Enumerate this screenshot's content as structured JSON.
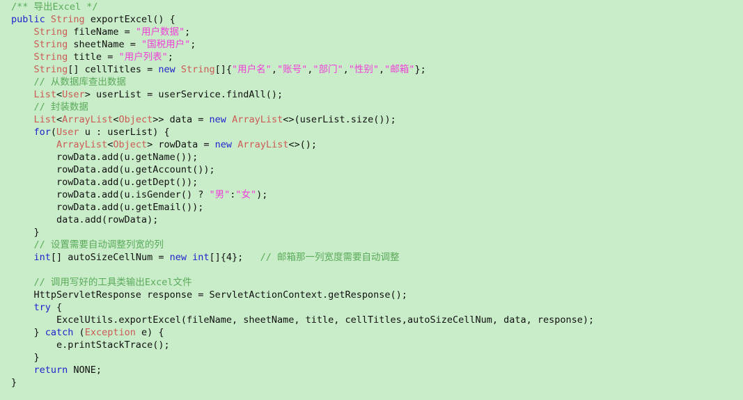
{
  "editor": {
    "language": "Java",
    "background_color": "#c9edc9",
    "colors": {
      "keyword": "#2222cc",
      "type": "#cc5a55",
      "string": "#ef3fd8",
      "comment": "#5aaa5a",
      "plain": "#101010"
    }
  },
  "code": {
    "lines": [
      {
        "id": 1,
        "tokens": [
          {
            "t": "cmt",
            "v": "/** 导出Excel */"
          }
        ]
      },
      {
        "id": 2,
        "tokens": [
          {
            "t": "kw",
            "v": "public"
          },
          {
            "t": "pln",
            "v": " "
          },
          {
            "t": "typ",
            "v": "String"
          },
          {
            "t": "pln",
            "v": " exportExcel() {"
          }
        ]
      },
      {
        "id": 3,
        "tokens": [
          {
            "t": "pln",
            "v": "    "
          },
          {
            "t": "typ",
            "v": "String"
          },
          {
            "t": "pln",
            "v": " fileName = "
          },
          {
            "t": "str",
            "v": "\"用户数据\""
          },
          {
            "t": "pln",
            "v": ";"
          }
        ]
      },
      {
        "id": 4,
        "tokens": [
          {
            "t": "pln",
            "v": "    "
          },
          {
            "t": "typ",
            "v": "String"
          },
          {
            "t": "pln",
            "v": " sheetName = "
          },
          {
            "t": "str",
            "v": "\"国税用户\""
          },
          {
            "t": "pln",
            "v": ";"
          }
        ]
      },
      {
        "id": 5,
        "tokens": [
          {
            "t": "pln",
            "v": "    "
          },
          {
            "t": "typ",
            "v": "String"
          },
          {
            "t": "pln",
            "v": " title = "
          },
          {
            "t": "str",
            "v": "\"用户列表\""
          },
          {
            "t": "pln",
            "v": ";"
          }
        ]
      },
      {
        "id": 6,
        "tokens": [
          {
            "t": "pln",
            "v": "    "
          },
          {
            "t": "typ",
            "v": "String"
          },
          {
            "t": "pln",
            "v": "[] cellTitles = "
          },
          {
            "t": "kw",
            "v": "new"
          },
          {
            "t": "pln",
            "v": " "
          },
          {
            "t": "typ",
            "v": "String"
          },
          {
            "t": "pln",
            "v": "[]{"
          },
          {
            "t": "str",
            "v": "\"用户名\""
          },
          {
            "t": "pln",
            "v": ","
          },
          {
            "t": "str",
            "v": "\"账号\""
          },
          {
            "t": "pln",
            "v": ","
          },
          {
            "t": "str",
            "v": "\"部门\""
          },
          {
            "t": "pln",
            "v": ","
          },
          {
            "t": "str",
            "v": "\"性别\""
          },
          {
            "t": "pln",
            "v": ","
          },
          {
            "t": "str",
            "v": "\"邮箱\""
          },
          {
            "t": "pln",
            "v": "};"
          }
        ]
      },
      {
        "id": 7,
        "tokens": [
          {
            "t": "pln",
            "v": "    "
          },
          {
            "t": "cmt",
            "v": "// 从数据库查出数据"
          }
        ]
      },
      {
        "id": 8,
        "tokens": [
          {
            "t": "pln",
            "v": "    "
          },
          {
            "t": "typ",
            "v": "List"
          },
          {
            "t": "pln",
            "v": "<"
          },
          {
            "t": "typ",
            "v": "User"
          },
          {
            "t": "pln",
            "v": "> userList = userService.findAll();"
          }
        ]
      },
      {
        "id": 9,
        "tokens": [
          {
            "t": "pln",
            "v": "    "
          },
          {
            "t": "cmt",
            "v": "// 封装数据"
          }
        ]
      },
      {
        "id": 10,
        "tokens": [
          {
            "t": "pln",
            "v": "    "
          },
          {
            "t": "typ",
            "v": "List"
          },
          {
            "t": "pln",
            "v": "<"
          },
          {
            "t": "typ",
            "v": "ArrayList"
          },
          {
            "t": "pln",
            "v": "<"
          },
          {
            "t": "typ",
            "v": "Object"
          },
          {
            "t": "pln",
            "v": ">> data = "
          },
          {
            "t": "kw",
            "v": "new"
          },
          {
            "t": "pln",
            "v": " "
          },
          {
            "t": "typ",
            "v": "ArrayList"
          },
          {
            "t": "pln",
            "v": "<>(userList.size());"
          }
        ]
      },
      {
        "id": 11,
        "tokens": [
          {
            "t": "pln",
            "v": "    "
          },
          {
            "t": "kw",
            "v": "for"
          },
          {
            "t": "pln",
            "v": "("
          },
          {
            "t": "typ",
            "v": "User"
          },
          {
            "t": "pln",
            "v": " u : userList) {"
          }
        ]
      },
      {
        "id": 12,
        "tokens": [
          {
            "t": "pln",
            "v": "        "
          },
          {
            "t": "typ",
            "v": "ArrayList"
          },
          {
            "t": "pln",
            "v": "<"
          },
          {
            "t": "typ",
            "v": "Object"
          },
          {
            "t": "pln",
            "v": "> rowData = "
          },
          {
            "t": "kw",
            "v": "new"
          },
          {
            "t": "pln",
            "v": " "
          },
          {
            "t": "typ",
            "v": "ArrayList"
          },
          {
            "t": "pln",
            "v": "<>();"
          }
        ]
      },
      {
        "id": 13,
        "tokens": [
          {
            "t": "pln",
            "v": "        rowData.add(u.getName());"
          }
        ]
      },
      {
        "id": 14,
        "tokens": [
          {
            "t": "pln",
            "v": "        rowData.add(u.getAccount());"
          }
        ]
      },
      {
        "id": 15,
        "tokens": [
          {
            "t": "pln",
            "v": "        rowData.add(u.getDept());"
          }
        ]
      },
      {
        "id": 16,
        "tokens": [
          {
            "t": "pln",
            "v": "        rowData.add(u.isGender() ? "
          },
          {
            "t": "str",
            "v": "\"男\""
          },
          {
            "t": "pln",
            "v": ":"
          },
          {
            "t": "str",
            "v": "\"女\""
          },
          {
            "t": "pln",
            "v": ");"
          }
        ]
      },
      {
        "id": 17,
        "tokens": [
          {
            "t": "pln",
            "v": "        rowData.add(u.getEmail());"
          }
        ]
      },
      {
        "id": 18,
        "tokens": [
          {
            "t": "pln",
            "v": "        data.add(rowData);"
          }
        ]
      },
      {
        "id": 19,
        "tokens": [
          {
            "t": "pln",
            "v": "    }"
          }
        ]
      },
      {
        "id": 20,
        "tokens": [
          {
            "t": "pln",
            "v": "    "
          },
          {
            "t": "cmt",
            "v": "// 设置需要自动调整列宽的列"
          }
        ]
      },
      {
        "id": 21,
        "tokens": [
          {
            "t": "pln",
            "v": "    "
          },
          {
            "t": "kw",
            "v": "int"
          },
          {
            "t": "pln",
            "v": "[] autoSizeCellNum = "
          },
          {
            "t": "kw",
            "v": "new"
          },
          {
            "t": "pln",
            "v": " "
          },
          {
            "t": "kw",
            "v": "int"
          },
          {
            "t": "pln",
            "v": "[]{4};   "
          },
          {
            "t": "cmt",
            "v": "// 邮箱那一列宽度需要自动调整"
          }
        ]
      },
      {
        "id": 22,
        "tokens": []
      },
      {
        "id": 23,
        "tokens": [
          {
            "t": "pln",
            "v": "    "
          },
          {
            "t": "cmt",
            "v": "// 调用写好的工具类输出Excel文件"
          }
        ]
      },
      {
        "id": 24,
        "tokens": [
          {
            "t": "pln",
            "v": "    HttpServletResponse response = ServletActionContext.getResponse();"
          }
        ]
      },
      {
        "id": 25,
        "tokens": [
          {
            "t": "pln",
            "v": "    "
          },
          {
            "t": "kw",
            "v": "try"
          },
          {
            "t": "pln",
            "v": " {"
          }
        ]
      },
      {
        "id": 26,
        "tokens": [
          {
            "t": "pln",
            "v": "        ExcelUtils.exportExcel(fileName, sheetName, title, cellTitles,autoSizeCellNum, data, response);"
          }
        ]
      },
      {
        "id": 27,
        "tokens": [
          {
            "t": "pln",
            "v": "    } "
          },
          {
            "t": "kw",
            "v": "catch"
          },
          {
            "t": "pln",
            "v": " ("
          },
          {
            "t": "typ",
            "v": "Exception"
          },
          {
            "t": "pln",
            "v": " e) {"
          }
        ]
      },
      {
        "id": 28,
        "tokens": [
          {
            "t": "pln",
            "v": "        e.printStackTrace();"
          }
        ]
      },
      {
        "id": 29,
        "tokens": [
          {
            "t": "pln",
            "v": "    }"
          }
        ]
      },
      {
        "id": 30,
        "tokens": [
          {
            "t": "pln",
            "v": "    "
          },
          {
            "t": "kw",
            "v": "return"
          },
          {
            "t": "pln",
            "v": " NONE;"
          }
        ]
      },
      {
        "id": 31,
        "tokens": [
          {
            "t": "pln",
            "v": "}"
          }
        ]
      }
    ]
  }
}
